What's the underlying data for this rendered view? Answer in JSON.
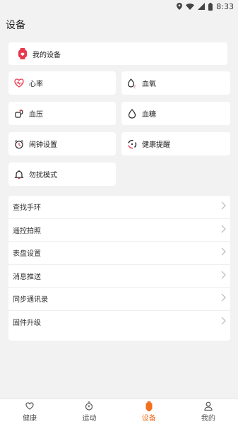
{
  "status_bar": {
    "time": "8:33"
  },
  "header": {
    "title": "设备"
  },
  "my_device": {
    "label": "我的设备"
  },
  "features": [
    {
      "label": "心率",
      "icon": "heart-rate-icon"
    },
    {
      "label": "血氧",
      "icon": "blood-oxygen-icon"
    },
    {
      "label": "血压",
      "icon": "blood-pressure-icon"
    },
    {
      "label": "血糖",
      "icon": "blood-sugar-icon"
    },
    {
      "label": "闹钟设置",
      "icon": "alarm-icon"
    },
    {
      "label": "健康提醒",
      "icon": "health-reminder-icon"
    },
    {
      "label": "勿扰模式",
      "icon": "do-not-disturb-icon"
    }
  ],
  "settings_list": [
    {
      "label": "查找手环"
    },
    {
      "label": "遥控拍照"
    },
    {
      "label": "表盘设置"
    },
    {
      "label": "消息推送"
    },
    {
      "label": "同步通讯录"
    },
    {
      "label": "固件升级"
    }
  ],
  "tabs": [
    {
      "label": "健康",
      "icon": "heart-outline-icon"
    },
    {
      "label": "运动",
      "icon": "stopwatch-icon"
    },
    {
      "label": "设备",
      "icon": "watch-icon"
    },
    {
      "label": "我的",
      "icon": "person-icon"
    }
  ],
  "colors": {
    "accent": "#f07020",
    "device_red": "#e8384f",
    "background": "#f2f2f2"
  }
}
